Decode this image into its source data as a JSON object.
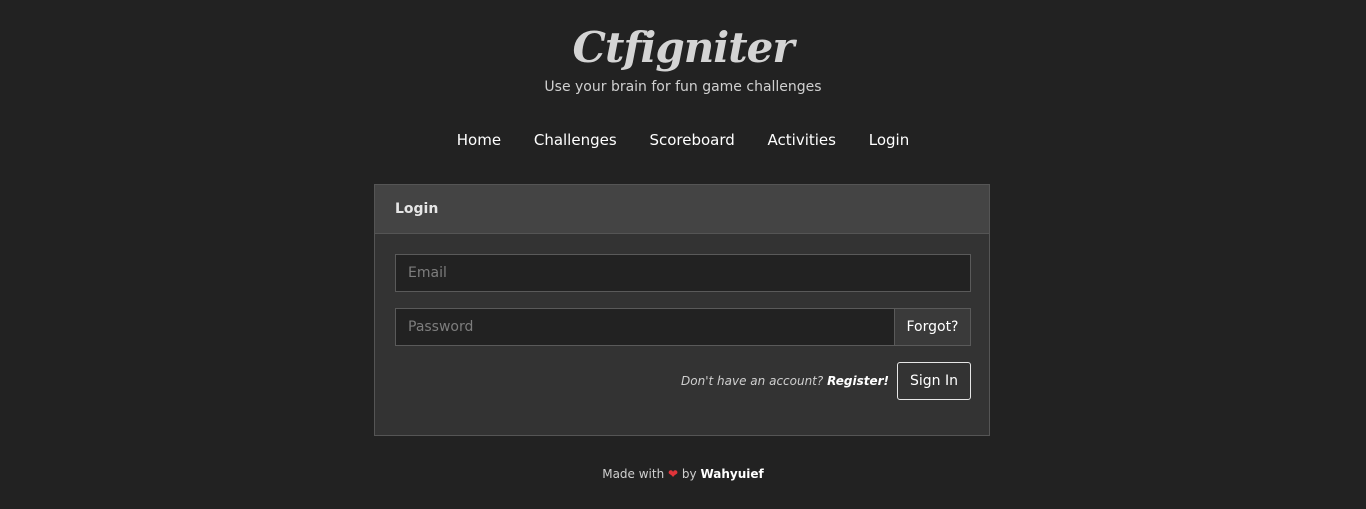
{
  "brand": {
    "title": "Ctfigniter",
    "tagline": "Use your brain for fun game challenges"
  },
  "nav": {
    "items": [
      "Home",
      "Challenges",
      "Scoreboard",
      "Activities",
      "Login"
    ]
  },
  "login_panel": {
    "heading": "Login",
    "email_placeholder": "Email",
    "email_value": "",
    "password_placeholder": "Password",
    "password_value": "",
    "forgot_label": "Forgot?",
    "no_account_text": "Don't have an account?",
    "register_label": "Register!",
    "signin_label": "Sign In"
  },
  "footer": {
    "made_with": "Made with",
    "heart_icon": "heart-icon",
    "heart_glyph": "❤",
    "by": "by",
    "author": "Wahyuief"
  },
  "colors": {
    "background": "#222222",
    "panel": "#333333",
    "panel_heading": "#444444",
    "heart": "#e0343a"
  }
}
